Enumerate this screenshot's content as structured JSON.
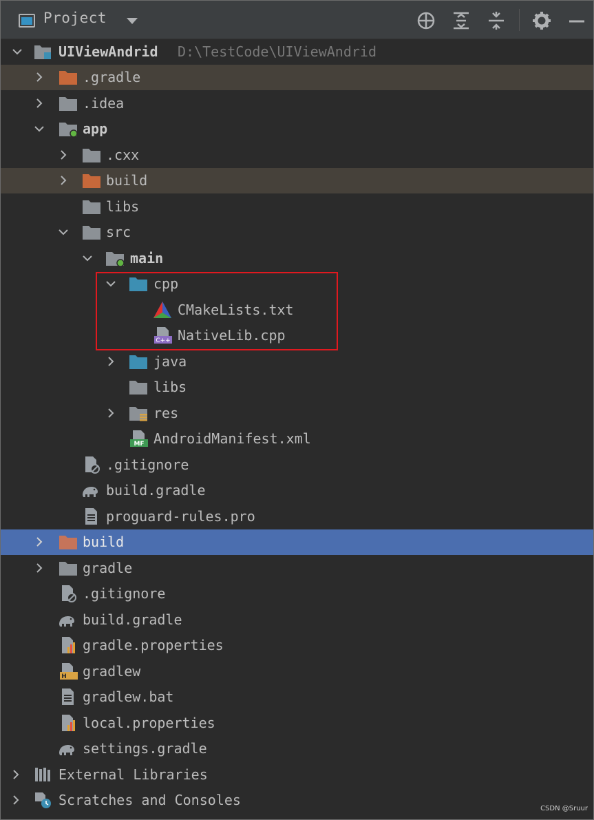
{
  "toolbar": {
    "title": "Project",
    "buttons": [
      "locate-icon",
      "expand-all-icon",
      "collapse-all-icon",
      "gear-icon",
      "minimize-icon"
    ]
  },
  "tree": {
    "root_label": "UIViewAndrid",
    "root_path": "D:\\TestCode\\UIViewAndrid",
    "items": [
      {
        "label": ".gradle"
      },
      {
        "label": ".idea"
      },
      {
        "label": "app"
      },
      {
        "label": ".cxx"
      },
      {
        "label": "build"
      },
      {
        "label": "libs"
      },
      {
        "label": "src"
      },
      {
        "label": "main"
      },
      {
        "label": "cpp"
      },
      {
        "label": "CMakeLists.txt"
      },
      {
        "label": "NativeLib.cpp"
      },
      {
        "label": "java"
      },
      {
        "label": "libs"
      },
      {
        "label": "res"
      },
      {
        "label": "AndroidManifest.xml"
      },
      {
        "label": ".gitignore"
      },
      {
        "label": "build.gradle"
      },
      {
        "label": "proguard-rules.pro"
      },
      {
        "label": "build"
      },
      {
        "label": "gradle"
      },
      {
        "label": ".gitignore"
      },
      {
        "label": "build.gradle"
      },
      {
        "label": "gradle.properties"
      },
      {
        "label": "gradlew"
      },
      {
        "label": "gradlew.bat"
      },
      {
        "label": "local.properties"
      },
      {
        "label": "settings.gradle"
      },
      {
        "label": "External Libraries"
      },
      {
        "label": "Scratches and Consoles"
      }
    ]
  },
  "colors": {
    "background": "#2b2b2b",
    "toolbar": "#3c3f41",
    "selection": "#4b6eaf",
    "excluded_row": "#46413a",
    "excluded_folder": "#c7683a",
    "folder": "#8c9196",
    "source_folder": "#3d8fb3",
    "highlight_box": "#e0191f"
  },
  "watermark": "CSDN @Sruur"
}
